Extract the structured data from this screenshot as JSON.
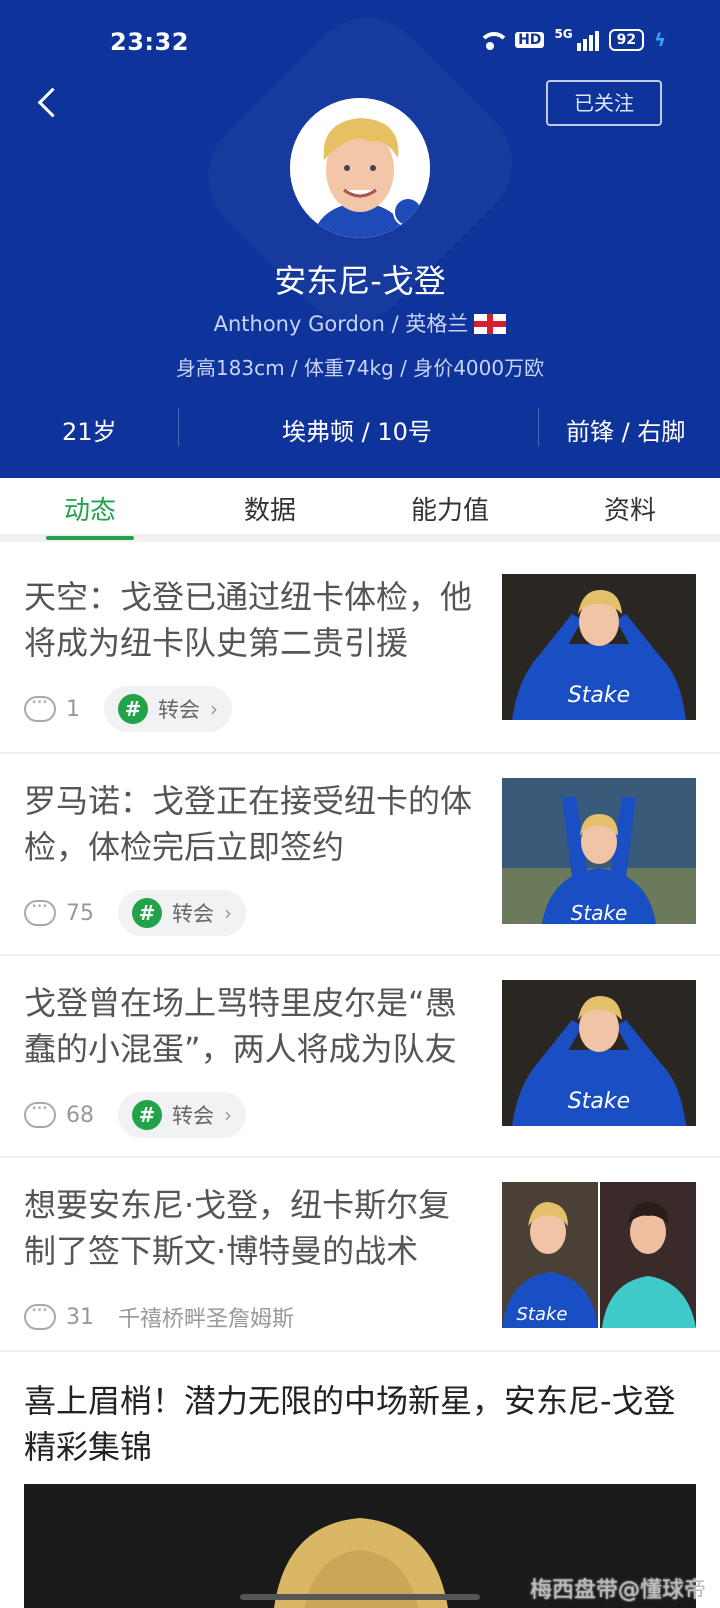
{
  "status": {
    "time": "23:32",
    "hd": "HD",
    "network": "5G",
    "battery": "92"
  },
  "header": {
    "follow_label": "已关注",
    "name": "安东尼-戈登",
    "sub": "Anthony Gordon / 英格兰",
    "physical": "身高183cm / 体重74kg / 身价4000万欧",
    "age": "21岁",
    "club": "埃弗顿 / 10号",
    "position": "前锋 / 右脚"
  },
  "tabs": [
    {
      "label": "动态"
    },
    {
      "label": "数据"
    },
    {
      "label": "能力值"
    },
    {
      "label": "资料"
    }
  ],
  "feed": [
    {
      "title": "天空：戈登已通过纽卡体检，他将成为纽卡队史第二贵引援",
      "comments": "1",
      "tag": "转会"
    },
    {
      "title": "罗马诺：戈登正在接受纽卡的体检，体检完后立即签约",
      "comments": "75",
      "tag": "转会"
    },
    {
      "title": "戈登曾在场上骂特里皮尔是“愚蠢的小混蛋”，两人将成为队友",
      "comments": "68",
      "tag": "转会"
    },
    {
      "title": "想要安东尼·戈登，纽卡斯尔复制了签下斯文·博特曼的战术",
      "comments": "31",
      "source": "千禧桥畔圣詹姆斯"
    }
  ],
  "video": {
    "title": "喜上眉梢！潜力无限的中场新星，安东尼-戈登精彩集锦"
  },
  "watermark": "梅西盘带@懂球帝",
  "colors": {
    "header_bg": "#0e339b",
    "accent": "#22a34a"
  }
}
